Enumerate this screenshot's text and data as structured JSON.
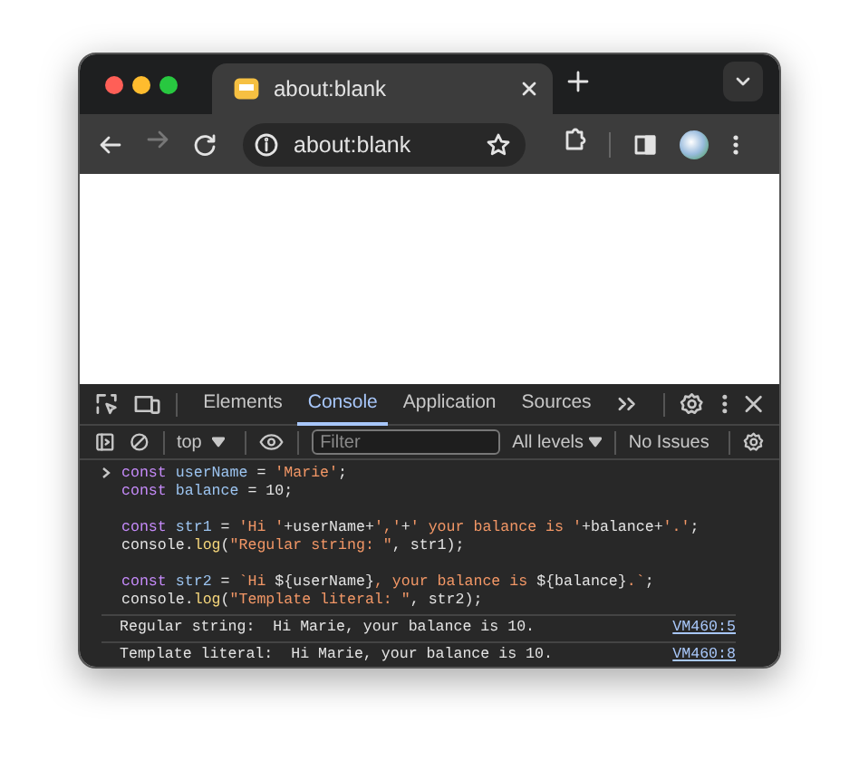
{
  "tab": {
    "title": "about:blank"
  },
  "address_bar": {
    "url": "about:blank"
  },
  "devtools": {
    "tabs": [
      {
        "label": "Elements",
        "selected": false
      },
      {
        "label": "Console",
        "selected": true
      },
      {
        "label": "Application",
        "selected": false
      },
      {
        "label": "Sources",
        "selected": false
      }
    ]
  },
  "console_toolbar": {
    "context": "top",
    "filter": {
      "placeholder": "Filter"
    },
    "levels": "All levels",
    "issues": "No Issues"
  },
  "console": {
    "input_blocks": [
      {
        "lines": [
          [
            {
              "kind": "keyword",
              "text": "const"
            },
            {
              "kind": "ident",
              "text": " userName"
            },
            {
              "kind": "plain",
              "text": " = "
            },
            {
              "kind": "string",
              "text": "'Marie'"
            },
            {
              "kind": "plain",
              "text": ";"
            }
          ],
          [
            {
              "kind": "keyword",
              "text": "const"
            },
            {
              "kind": "ident",
              "text": " balance"
            },
            {
              "kind": "plain",
              "text": " = 10;"
            }
          ]
        ]
      },
      {
        "lines": [
          [
            {
              "kind": "keyword",
              "text": "const"
            },
            {
              "kind": "ident",
              "text": " str1"
            },
            {
              "kind": "plain",
              "text": " = "
            },
            {
              "kind": "string",
              "text": "'Hi '"
            },
            {
              "kind": "plain",
              "text": "+userName+"
            },
            {
              "kind": "string",
              "text": "','"
            },
            {
              "kind": "plain",
              "text": "+"
            },
            {
              "kind": "string",
              "text": "' your balance is '"
            },
            {
              "kind": "plain",
              "text": "+balance+"
            },
            {
              "kind": "string",
              "text": "'.'"
            },
            {
              "kind": "plain",
              "text": ";"
            }
          ],
          [
            {
              "kind": "plain",
              "text": "console."
            },
            {
              "kind": "func",
              "text": "log"
            },
            {
              "kind": "plain",
              "text": "("
            },
            {
              "kind": "string",
              "text": "\"Regular string: \""
            },
            {
              "kind": "plain",
              "text": ", str1);"
            }
          ]
        ]
      },
      {
        "lines": [
          [
            {
              "kind": "keyword",
              "text": "const"
            },
            {
              "kind": "ident",
              "text": " str2"
            },
            {
              "kind": "plain",
              "text": " = "
            },
            {
              "kind": "string",
              "text": "`Hi "
            },
            {
              "kind": "plain",
              "text": "${userName}"
            },
            {
              "kind": "string",
              "text": ", your balance is "
            },
            {
              "kind": "plain",
              "text": "${balance}"
            },
            {
              "kind": "string",
              "text": ".`"
            },
            {
              "kind": "plain",
              "text": ";"
            }
          ],
          [
            {
              "kind": "plain",
              "text": "console."
            },
            {
              "kind": "func",
              "text": "log"
            },
            {
              "kind": "plain",
              "text": "("
            },
            {
              "kind": "string",
              "text": "\"Template literal: \""
            },
            {
              "kind": "plain",
              "text": ", str2);"
            }
          ]
        ]
      }
    ],
    "messages": [
      {
        "text": "Regular string:  Hi Marie, your balance is 10.",
        "source": "VM460:5"
      },
      {
        "text": "Template literal:  Hi Marie, your balance is 10.",
        "source": "VM460:8"
      }
    ]
  }
}
